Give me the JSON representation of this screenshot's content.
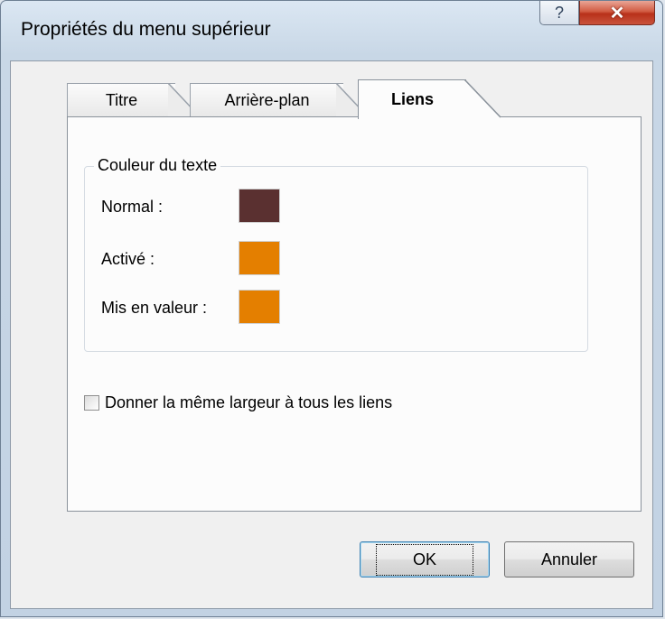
{
  "window": {
    "title": "Propriétés du menu supérieur",
    "help_glyph": "?",
    "close_glyph": "✕"
  },
  "tabs": [
    {
      "label": "Titre"
    },
    {
      "label": "Arrière-plan"
    },
    {
      "label": "Liens"
    }
  ],
  "active_tab": "Liens",
  "text_color_group": {
    "label": "Couleur du texte",
    "rows": [
      {
        "label": "Normal :",
        "color": "#5a3030"
      },
      {
        "label": "Activé :",
        "color": "#e47f00"
      },
      {
        "label": "Mis en valeur :",
        "color": "#e47f00"
      }
    ]
  },
  "same_width_option": {
    "label": "Donner la même largeur à tous les liens",
    "checked": false
  },
  "buttons": {
    "ok_label": "OK",
    "cancel_label": "Annuler"
  }
}
